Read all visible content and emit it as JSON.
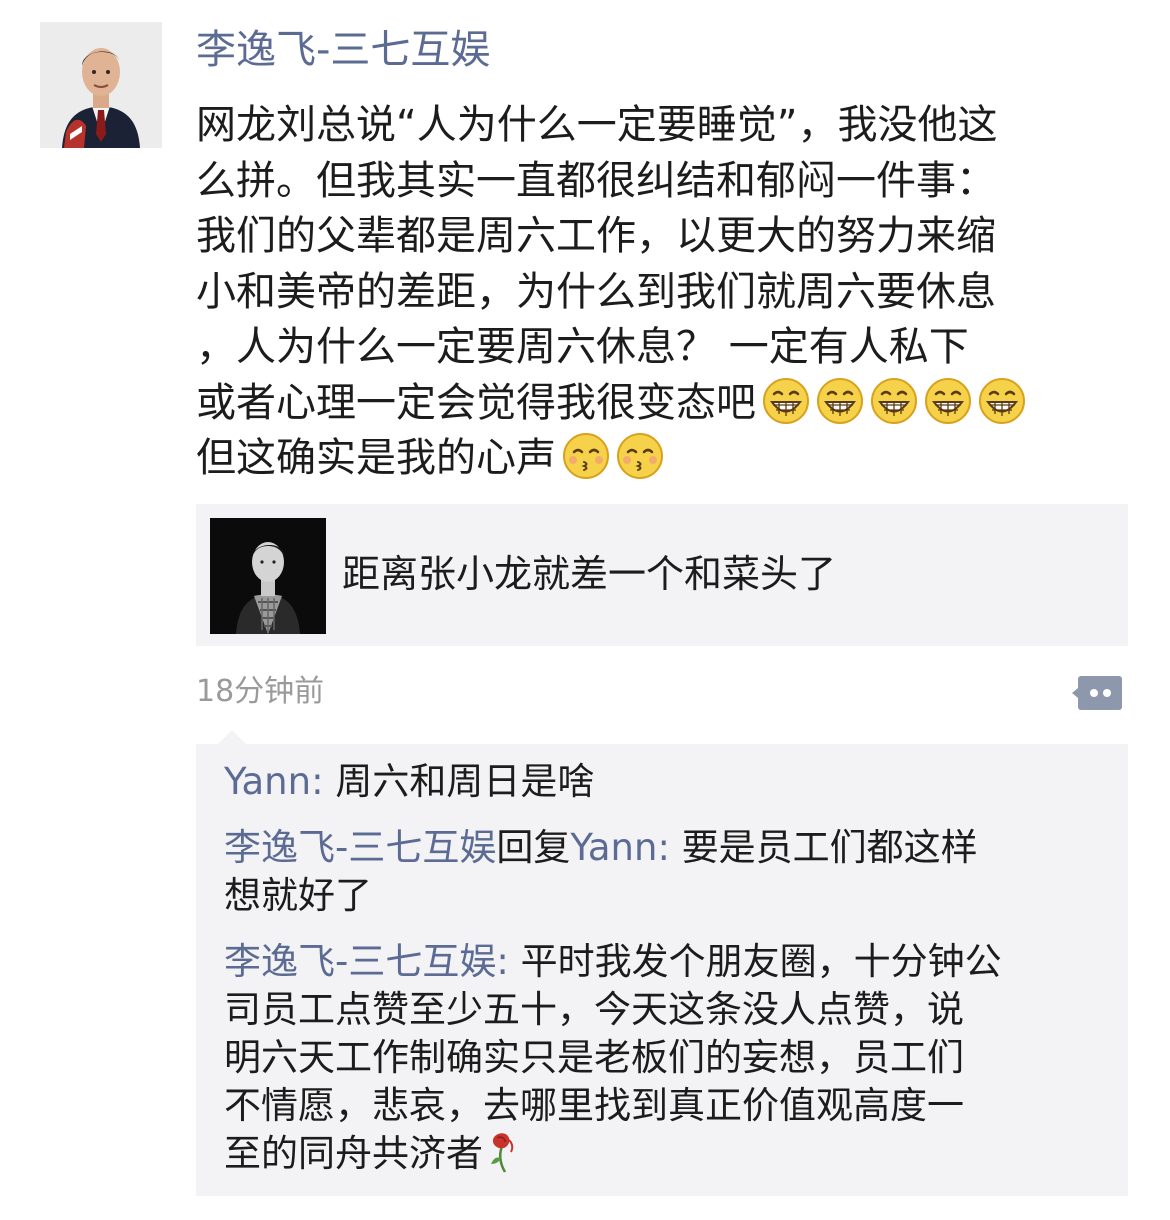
{
  "post": {
    "author": "李逸飞-三七互娱",
    "text_lines": [
      "网龙刘总说“人为什么一定要睡觉”，我没他这",
      "么拼。但我其实一直都很纠结和郁闷一件事：",
      "我们的父辈都是周六工作，以更大的努力来缩",
      "小和美帝的差距，为什么到我们就周六要休息",
      "，人为什么一定要周六休息？  一定有人私下",
      "或者心理一定会觉得我很变态吧",
      "但这确实是我的心声"
    ],
    "grin_emoji": "grinning-face-emoji",
    "grin_count": 5,
    "kiss_emoji": "kissing-face-emoji",
    "kiss_count": 2,
    "time": "18分钟前"
  },
  "link_card": {
    "title": "距离张小龙就差一个和菜头了",
    "thumb_icon": "person-photo-thumbnail"
  },
  "comments": [
    {
      "name": "Yann",
      "sep": ": ",
      "lines": [
        "周六和周日是啥"
      ]
    },
    {
      "name": "李逸飞-三七互娱",
      "reply_word": "回复",
      "reply_to": "Yann",
      "sep": ": ",
      "lines": [
        "要是员工们都这样",
        "想就好了"
      ]
    },
    {
      "name": "李逸飞-三七互娱",
      "sep": ": ",
      "lines": [
        "平时我发个朋友圈，十分钟公",
        "司员工点赞至少五十，今天这条没人点赞，说",
        "明六天工作制确实只是老板们的妄想，员工们",
        "不情愿，悲哀，去哪里找到真正价值观高度一",
        "至的同舟共济者"
      ],
      "end_emoji": "wilted-rose-emoji"
    }
  ],
  "icons": {
    "comment_button": "comment-dots-icon"
  },
  "colors": {
    "nickname": "#5b6b93",
    "card_bg": "#f3f3f5",
    "time": "#9a9a9a"
  }
}
